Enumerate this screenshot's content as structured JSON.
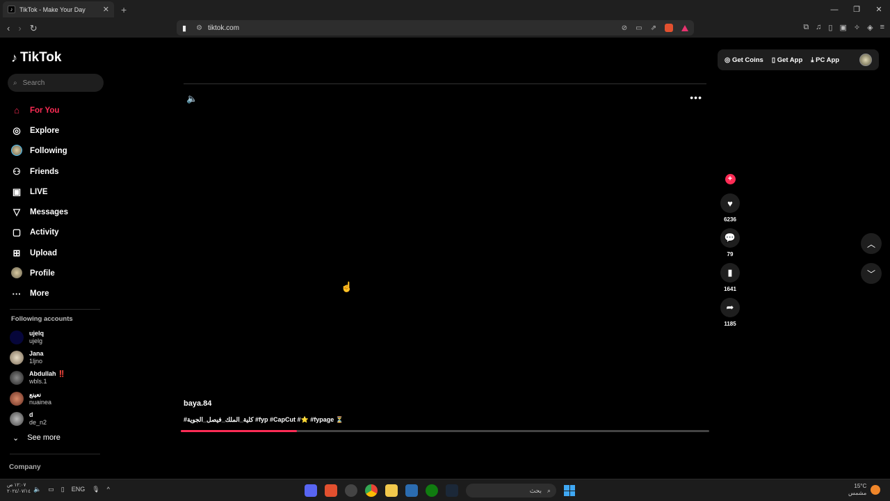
{
  "browser": {
    "tab_title": "TikTok - Make Your Day",
    "url": "tiktok.com"
  },
  "sidebar": {
    "logo": "TikTok",
    "search_placeholder": "Search",
    "menu": [
      {
        "label": "For You",
        "icon": "home-icon"
      },
      {
        "label": "Explore",
        "icon": "compass-icon"
      },
      {
        "label": "Following",
        "icon": "avatar-icon"
      },
      {
        "label": "Friends",
        "icon": "friends-icon"
      },
      {
        "label": "LIVE",
        "icon": "live-icon"
      },
      {
        "label": "Messages",
        "icon": "send-icon"
      },
      {
        "label": "Activity",
        "icon": "activity-icon"
      },
      {
        "label": "Upload",
        "icon": "upload-icon"
      },
      {
        "label": "Profile",
        "icon": "avatar-icon"
      },
      {
        "label": "More",
        "icon": "more-icon"
      }
    ],
    "following_title": "Following accounts",
    "accounts": [
      {
        "name": "ujelq",
        "handle": "ujelg",
        "color": "#06063a"
      },
      {
        "name": "Jana",
        "handle": "1ljno",
        "color": "#c9b79a"
      },
      {
        "name": "Abdullah ‼️",
        "handle": "wbls.1",
        "color": "#2a2a2a"
      },
      {
        "name": "نعينع",
        "handle": "nuainea",
        "color": "#b5684d"
      },
      {
        "name": "d",
        "handle": "de_n2",
        "color": "#8c8c8c"
      }
    ],
    "see_more": "See more",
    "company": "Company"
  },
  "topright": {
    "get_coins": "Get Coins",
    "get_app": "Get App",
    "pc_app": "PC App"
  },
  "video": {
    "author": "baya.84",
    "caption": "#كلية_الملك_فيصل_الجوية #fyp #CapCut #⭐ #fypage ⏳",
    "progress": 0.22,
    "likes": "6236",
    "comments": "79",
    "saves": "1641",
    "shares": "1185"
  },
  "taskbar": {
    "time": "١٢:٠٧ ص",
    "date": "٢٠٢٤/٠٧/١٤",
    "lang": "ENG",
    "search_label": "بحث",
    "weather_temp": "15°C",
    "weather_desc": "مشمس"
  }
}
